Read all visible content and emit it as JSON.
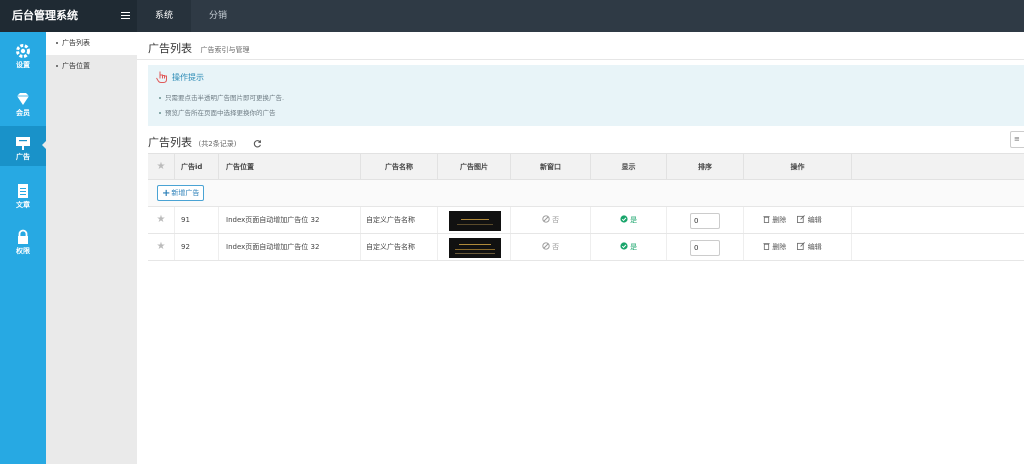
{
  "app": {
    "title": "后台管理系统"
  },
  "topnav": {
    "tabs": [
      {
        "label": "系统",
        "active": true
      },
      {
        "label": "分销",
        "active": false
      }
    ]
  },
  "iconbar": {
    "items": [
      {
        "label": "设置",
        "icon": "gear-icon"
      },
      {
        "label": "会员",
        "icon": "diamond-icon"
      },
      {
        "label": "广告",
        "icon": "billboard-icon",
        "active": true
      },
      {
        "label": "文章",
        "icon": "document-icon"
      },
      {
        "label": "权限",
        "icon": "lock-icon"
      }
    ]
  },
  "subbar": {
    "items": [
      {
        "label": "广告列表",
        "active": true
      },
      {
        "label": "广告位置"
      }
    ]
  },
  "page": {
    "title": "广告列表",
    "subtitle": "广告索引与管理"
  },
  "tips": {
    "title": "操作提示",
    "lines": [
      "只需要点击半透明广告图片即可更换广告.",
      "预览广告所在页面中选择更换你的广告"
    ]
  },
  "list": {
    "title": "广告列表",
    "count": "(共2条记录)",
    "tool_label": "≡"
  },
  "table": {
    "headers": {
      "id": "广告id",
      "position": "广告位置",
      "name": "广告名称",
      "image": "广告图片",
      "new_window": "新窗口",
      "display": "显示",
      "sort": "排序",
      "action": "操作"
    },
    "add_label": "新增广告",
    "rows": [
      {
        "id": "91",
        "position": "Index页面自动增加广告位 32",
        "name": "自定义广告名称",
        "new_window": "否",
        "display": "是",
        "sort": "0",
        "delete": "删除",
        "edit": "编辑"
      },
      {
        "id": "92",
        "position": "Index页面自动增加广告位 32",
        "name": "自定义广告名称",
        "new_window": "否",
        "display": "是",
        "sort": "0",
        "delete": "删除",
        "edit": "编辑"
      }
    ]
  },
  "colors": {
    "topbar": "#2f3a45",
    "iconbar": "#27a9e3",
    "tips_bg": "#e8f4f8",
    "success": "#19a56b"
  }
}
